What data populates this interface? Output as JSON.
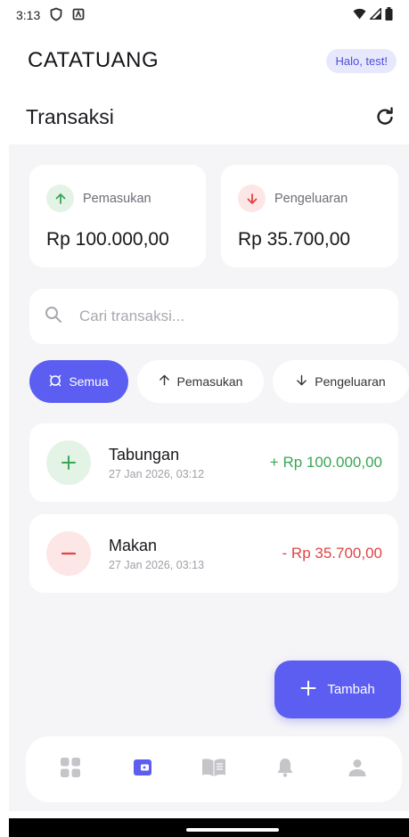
{
  "status_bar": {
    "time": "3:13"
  },
  "header": {
    "app_title": "CATATUANG",
    "greeting": "Halo, test!"
  },
  "page": {
    "title": "Transaksi"
  },
  "summary": {
    "income": {
      "label": "Pemasukan",
      "amount": "Rp 100.000,00"
    },
    "expense": {
      "label": "Pengeluaran",
      "amount": "Rp 35.700,00"
    }
  },
  "search": {
    "placeholder": "Cari transaksi..."
  },
  "filters": [
    {
      "label": "Semua",
      "active": true
    },
    {
      "label": "Pemasukan",
      "active": false
    },
    {
      "label": "Pengeluaran",
      "active": false
    }
  ],
  "transactions": [
    {
      "name": "Tabungan",
      "date": "27 Jan 2026, 03:12",
      "amount": "+ Rp 100.000,00",
      "type": "income"
    },
    {
      "name": "Makan",
      "date": "27 Jan 2026, 03:13",
      "amount": "- Rp 35.700,00",
      "type": "expense"
    }
  ],
  "fab": {
    "label": "Tambah"
  },
  "bottom_nav": [
    {
      "icon": "dashboard-icon",
      "active": false
    },
    {
      "icon": "wallet-icon",
      "active": true
    },
    {
      "icon": "book-icon",
      "active": false
    },
    {
      "icon": "bell-icon",
      "active": false
    },
    {
      "icon": "person-icon",
      "active": false
    }
  ],
  "colors": {
    "accent": "#5b5ef0",
    "income": "#3aa655",
    "expense": "#e04444",
    "background": "#f5f5f7"
  }
}
